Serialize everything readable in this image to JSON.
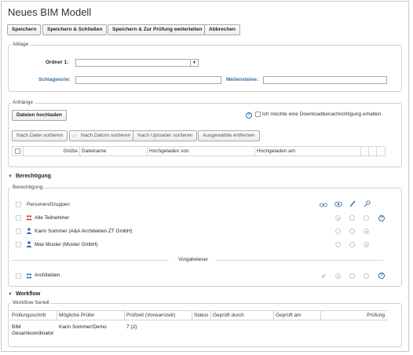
{
  "window": {
    "title": "Neues BIM Modell"
  },
  "toolbar": {
    "save": "Speichern",
    "save_close": "Speichern & Schließen",
    "save_forward": "Speichern & Zur Prüfung weiterleiten",
    "cancel": "Abbrechen"
  },
  "ablage": {
    "legend": "Ablage",
    "folder_label": "Ordner 1:",
    "folder_value": "",
    "keywords_label": "Schlagworte:",
    "keywords_value": "",
    "milestones_label": "Meilensteine:",
    "milestones_value": ""
  },
  "anhaenge": {
    "legend": "Anhänge",
    "upload": "Dateien hochladen",
    "notify_label": "Ich möchte eine Downloadbenachrichtigung erhalten.",
    "sort_buttons": [
      "Nach Datei sortieren",
      "Nach Datum sortieren",
      "Nach Uploader sortieren",
      "Ausgewählte entfernen"
    ],
    "columns": [
      "Größe",
      "Dateiname",
      "Hochgeladen von",
      "Hochgeladen am"
    ]
  },
  "berechtigung": {
    "section_title": "Berechtigung",
    "legend": "Berechtigung",
    "header_label": "Personen/Gruppen",
    "rows": [
      {
        "name": "Alle Teilnehmer",
        "type": "group-red",
        "read": "on",
        "write": "off",
        "admin": "off"
      },
      {
        "name": "Karin Sommer (A&A Architekten ZT GmbH)",
        "type": "person",
        "read": "off",
        "write": "off",
        "admin": "on"
      },
      {
        "name": "Max Muster (Muster GmbH)",
        "type": "person",
        "read": "off",
        "write": "off",
        "admin": "on"
      }
    ],
    "vorgabe_label": "Vorgabeleser",
    "vorgabe_rows": [
      {
        "name": "Architekten",
        "type": "group-blue",
        "checked": "✓",
        "read": "on",
        "write": "off",
        "admin": "off"
      }
    ]
  },
  "workflow": {
    "section_title": "Workflow",
    "legend": "Workflow Seriell",
    "columns": [
      "Prüfungsschritt",
      "Mögliche Prüfer",
      "Prüfzeit (Vorwarnzeit)",
      "Status",
      "Geprüft durch",
      "Geprüft am",
      "Prüfung"
    ],
    "rows": [
      {
        "step": "BIM Gesamkoordinator",
        "reviewer": "Karin Sommer/Demo",
        "time": "7 (2)",
        "status": "",
        "checked_by": "",
        "checked_at": "",
        "check": ""
      }
    ]
  },
  "colors": {
    "accent": "#3a6ea5",
    "group_red": "#c0392b",
    "border": "#d0d0d0"
  }
}
